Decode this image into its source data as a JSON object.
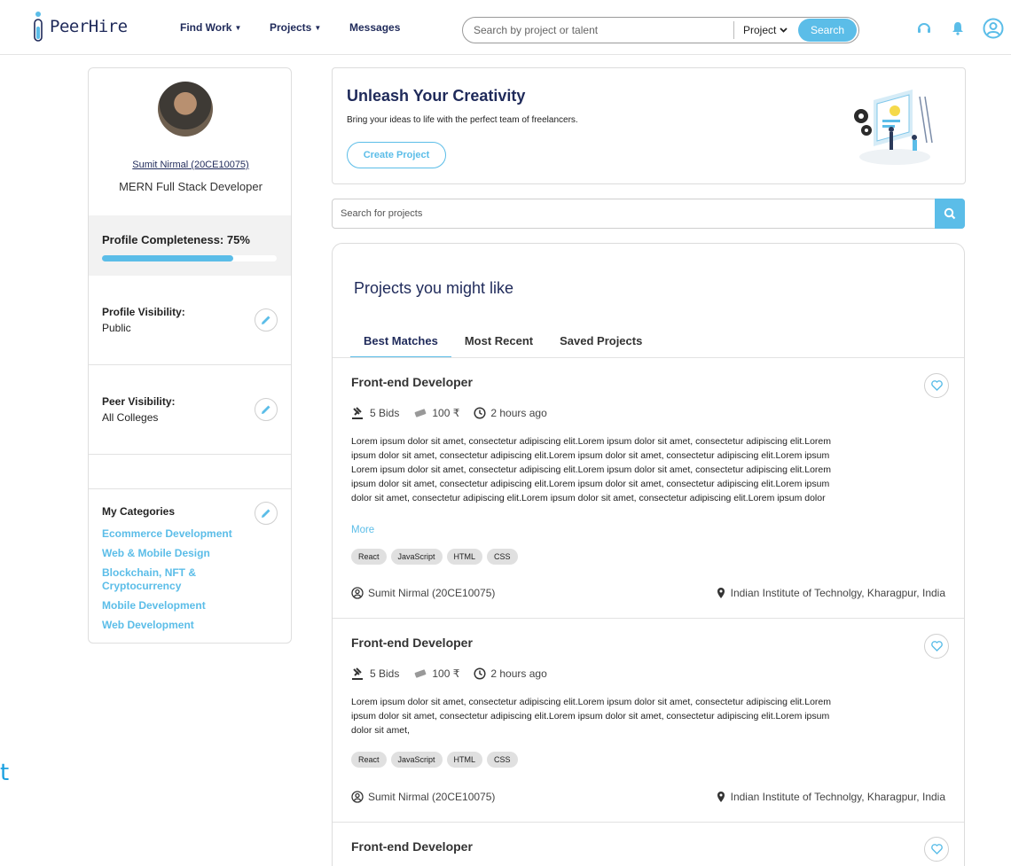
{
  "nav": {
    "brand": "PeerHire",
    "find_work": "Find Work",
    "projects": "Projects",
    "messages": "Messages",
    "search_placeholder": "Search by project or talent",
    "search_type": "Project",
    "search_button": "Search",
    "brand_color": "#1f2a5a",
    "accent_color": "#5bbde8"
  },
  "profile": {
    "name": "Sumit Nirmal (20CE10075)",
    "role": "MERN Full Stack Developer",
    "completeness_label": "Profile Completeness: 75%",
    "completeness_fraction": 0.75,
    "visibility_title": "Profile Visibility:",
    "visibility_value": "Public",
    "peer_title": "Peer Visibility:",
    "peer_value": "All Colleges",
    "categories_title": "My Categories",
    "categories": [
      "Ecommerce Development",
      "Web & Mobile Design",
      "Blockchain, NFT & Cryptocurrency",
      "Mobile Development",
      "Web Development"
    ]
  },
  "hero": {
    "title": "Unleash Your Creativity",
    "subtitle": "Bring your ideas to life with the perfect team of freelancers.",
    "cta": "Create Project"
  },
  "project_search": {
    "placeholder": "Search for projects"
  },
  "projects_panel": {
    "title": "Projects you might like",
    "tabs": [
      "Best Matches",
      "Most Recent",
      "Saved Projects"
    ],
    "items": [
      {
        "title": "Front-end Developer",
        "bids": "5 Bids",
        "price": "100 ₹",
        "time": "2 hours ago",
        "description_lines": [
          "Lorem ipsum dolor sit amet, consectetur adipiscing elit.Lorem ipsum dolor sit amet, consectetur adipiscing elit.Lorem",
          "ipsum dolor sit amet, consectetur adipiscing elit.Lorem ipsum dolor sit amet, consectetur adipiscing elit.Lorem ipsum",
          "Lorem ipsum dolor sit amet, consectetur adipiscing elit.Lorem ipsum dolor sit amet, consectetur adipiscing elit.Lorem",
          "ipsum dolor sit amet, consectetur adipiscing elit.Lorem ipsum dolor sit amet, consectetur adipiscing elit.Lorem ipsum",
          "dolor sit amet, consectetur adipiscing elit.Lorem ipsum dolor sit amet, consectetur adipiscing elit.Lorem ipsum dolor"
        ],
        "more": "More",
        "tags": [
          "React",
          "JavaScript",
          "HTML",
          "CSS"
        ],
        "owner": "Sumit Nirmal (20CE10075)",
        "location": "Indian Institute of Technolgy, Kharagpur, India"
      },
      {
        "title": "Front-end Developer",
        "bids": "5 Bids",
        "price": "100 ₹",
        "time": "2 hours ago",
        "description_lines": [
          "Lorem ipsum dolor sit amet, consectetur adipiscing elit.Lorem ipsum dolor sit amet, consectetur adipiscing elit.Lorem",
          "ipsum dolor sit amet, consectetur adipiscing elit.Lorem ipsum dolor sit amet, consectetur adipiscing elit.Lorem ipsum",
          "dolor sit amet,"
        ],
        "tags": [
          "React",
          "JavaScript",
          "HTML",
          "CSS"
        ],
        "owner": "Sumit Nirmal (20CE10075)",
        "location": "Indian Institute of Technolgy, Kharagpur, India"
      },
      {
        "title": "Front-end Developer"
      }
    ]
  },
  "stray_glyph": "t"
}
